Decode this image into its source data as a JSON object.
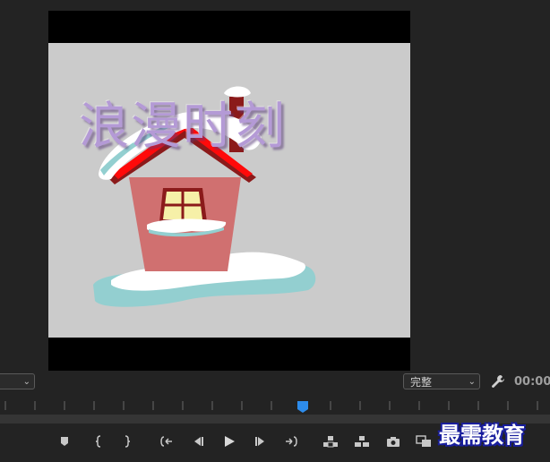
{
  "program_monitor": {
    "title_overlay_text": "浪漫时刻",
    "colors": {
      "letterbox": "#000000",
      "frame_bg": "#cbcbcb",
      "title": "#b49ad6"
    }
  },
  "toolbar": {
    "zoom_select_value": "",
    "quality_select_value": "完整",
    "settings_icon": "wrench-icon",
    "timecode": "00:00"
  },
  "playhead": {
    "color": "#2d8ceb",
    "position_fraction": 0.55
  },
  "transport": [
    {
      "name": "add-marker-button",
      "icon": "marker-icon"
    },
    {
      "name": "mark-in-button",
      "icon": "mark-in-icon"
    },
    {
      "name": "mark-out-button",
      "icon": "mark-out-icon"
    },
    {
      "name": "go-to-in-button",
      "icon": "go-to-in-icon"
    },
    {
      "name": "step-back-button",
      "icon": "step-back-icon"
    },
    {
      "name": "play-button",
      "icon": "play-icon"
    },
    {
      "name": "step-forward-button",
      "icon": "step-forward-icon"
    },
    {
      "name": "go-to-out-button",
      "icon": "go-to-out-icon"
    },
    {
      "name": "lift-button",
      "icon": "lift-icon"
    },
    {
      "name": "extract-button",
      "icon": "extract-icon"
    },
    {
      "name": "export-frame-button",
      "icon": "camera-icon"
    },
    {
      "name": "compare-view-button",
      "icon": "compare-icon"
    }
  ],
  "watermark": {
    "text": "最需教育"
  }
}
